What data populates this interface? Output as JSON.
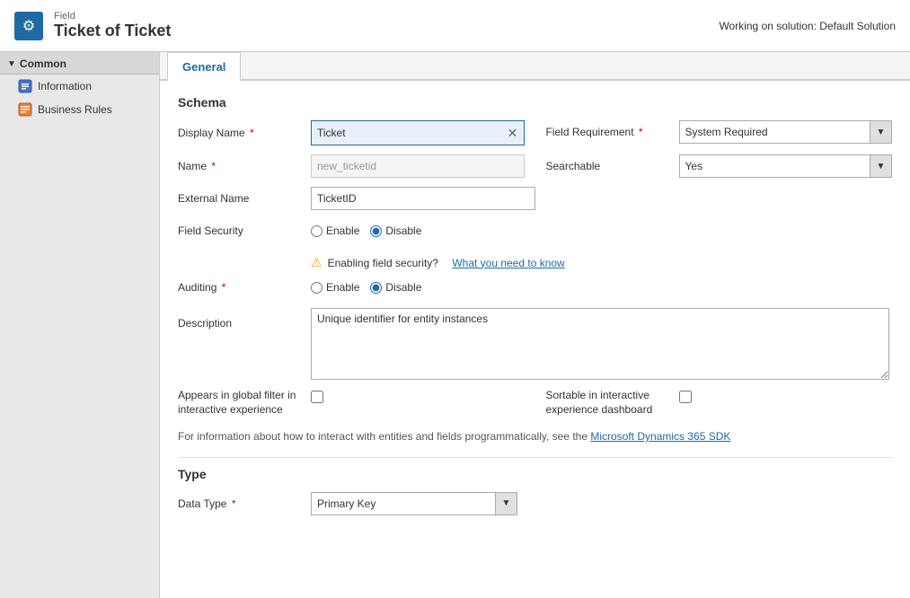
{
  "topbar": {
    "subtitle": "Field",
    "title": "Ticket of Ticket",
    "icon_label": "⚙",
    "working_on": "Working on solution: Default Solution"
  },
  "sidebar": {
    "section_label": "Common",
    "items": [
      {
        "label": "Information",
        "icon": "📋"
      },
      {
        "label": "Business Rules",
        "icon": "📋"
      }
    ]
  },
  "tabs": [
    {
      "label": "General",
      "active": true
    }
  ],
  "form": {
    "schema_section": "Schema",
    "display_name_label": "Display Name",
    "display_name_value": "Ticket",
    "name_label": "Name",
    "name_value": "new_ticketid",
    "external_name_label": "External Name",
    "external_name_value": "TicketID",
    "field_security_label": "Field Security",
    "field_security_enable": "Enable",
    "field_security_disable": "Disable",
    "field_security_selected": "Disable",
    "warning_text": "Enabling field security?",
    "warning_link": "What you need to know",
    "auditing_label": "Auditing",
    "auditing_enable": "Enable",
    "auditing_disable": "Disable",
    "auditing_selected": "Disable",
    "description_label": "Description",
    "description_value": "Unique identifier for entity instances",
    "appears_global_label": "Appears in global filter in interactive experience",
    "sortable_label": "Sortable in interactive experience dashboard",
    "info_text": "For information about how to interact with entities and fields programmatically, see the",
    "info_link": "Microsoft Dynamics 365 SDK",
    "type_section": "Type",
    "data_type_label": "Data Type",
    "data_type_value": "Primary Key",
    "field_requirement_label": "Field Requirement",
    "field_requirement_value": "System Required",
    "searchable_label": "Searchable",
    "searchable_value": "Yes"
  }
}
